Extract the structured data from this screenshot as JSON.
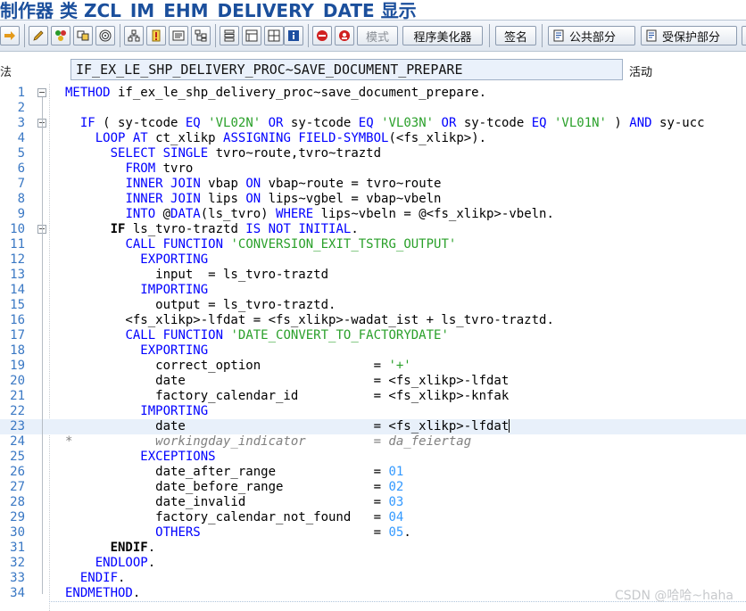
{
  "window": {
    "title_prefix": "制作器 类",
    "title_name": "ZCL_IM_EHM_DELIVERY_DATE",
    "title_suffix": "显示"
  },
  "toolbar": {
    "mode_label": "模式",
    "pretty_printer_label": "程序美化器",
    "signature_label": "签名",
    "public_section_label": "公共部分",
    "protected_section_label": "受保护部分"
  },
  "object": {
    "left_label": "法",
    "name": "IF_EX_LE_SHP_DELIVERY_PROC~SAVE_DOCUMENT_PREPARE",
    "status": "活动"
  },
  "code_lines": [
    {
      "n": "1",
      "text": "METHOD if_ex_le_shp_delivery_proc~save_document_prepare."
    },
    {
      "n": "2",
      "text": ""
    },
    {
      "n": "3",
      "text": "  IF ( sy-tcode EQ 'VL02N' OR sy-tcode EQ 'VL03N' OR sy-tcode EQ 'VL01N' ) AND sy-ucc"
    },
    {
      "n": "4",
      "text": "    LOOP AT ct_xlikp ASSIGNING FIELD-SYMBOL(<fs_xlikp>)."
    },
    {
      "n": "5",
      "text": "      SELECT SINGLE tvro~route,tvro~traztd"
    },
    {
      "n": "6",
      "text": "        FROM tvro"
    },
    {
      "n": "7",
      "text": "        INNER JOIN vbap ON vbap~route = tvro~route"
    },
    {
      "n": "8",
      "text": "        INNER JOIN lips ON lips~vgbel = vbap~vbeln"
    },
    {
      "n": "9",
      "text": "        INTO @DATA(ls_tvro) WHERE lips~vbeln = @<fs_xlikp>-vbeln."
    },
    {
      "n": "10",
      "text": "      IF ls_tvro-traztd IS NOT INITIAL."
    },
    {
      "n": "11",
      "text": "        CALL FUNCTION 'CONVERSION_EXIT_TSTRG_OUTPUT'"
    },
    {
      "n": "12",
      "text": "          EXPORTING"
    },
    {
      "n": "13",
      "text": "            input  = ls_tvro-traztd"
    },
    {
      "n": "14",
      "text": "          IMPORTING"
    },
    {
      "n": "15",
      "text": "            output = ls_tvro-traztd."
    },
    {
      "n": "16",
      "text": "        <fs_xlikp>-lfdat = <fs_xlikp>-wadat_ist + ls_tvro-traztd."
    },
    {
      "n": "17",
      "text": "        CALL FUNCTION 'DATE_CONVERT_TO_FACTORYDATE'"
    },
    {
      "n": "18",
      "text": "          EXPORTING"
    },
    {
      "n": "19",
      "text": "            correct_option               = '+'"
    },
    {
      "n": "20",
      "text": "            date                         = <fs_xlikp>-lfdat"
    },
    {
      "n": "21",
      "text": "            factory_calendar_id          = <fs_xlikp>-knfak"
    },
    {
      "n": "22",
      "text": "          IMPORTING"
    },
    {
      "n": "23",
      "text": "            date                         = <fs_xlikp>-lfdat"
    },
    {
      "n": "24",
      "text": "*           workingday_indicator         = da_feiertag"
    },
    {
      "n": "25",
      "text": "          EXCEPTIONS"
    },
    {
      "n": "26",
      "text": "            date_after_range             = 01"
    },
    {
      "n": "27",
      "text": "            date_before_range            = 02"
    },
    {
      "n": "28",
      "text": "            date_invalid                 = 03"
    },
    {
      "n": "29",
      "text": "            factory_calendar_not_found   = 04"
    },
    {
      "n": "30",
      "text": "            OTHERS                       = 05."
    },
    {
      "n": "31",
      "text": "      ENDIF."
    },
    {
      "n": "32",
      "text": "    ENDLOOP."
    },
    {
      "n": "33",
      "text": "  ENDIF."
    },
    {
      "n": "34",
      "text": "ENDMETHOD."
    }
  ],
  "watermark": "CSDN @哈哈~haha",
  "colors": {
    "keyword": "#0000ff",
    "string": "#2aa02a",
    "number": "#3399ff",
    "comment": "#808080",
    "line_number": "#3a78c4",
    "title": "#1b4f9c"
  }
}
